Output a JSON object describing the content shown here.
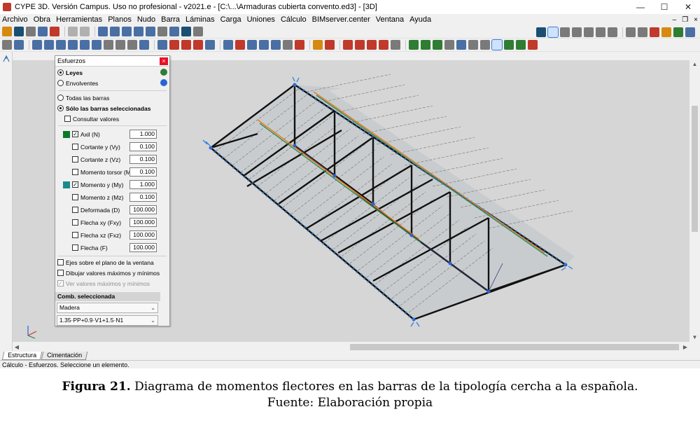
{
  "window": {
    "title": "CYPE 3D. Versión Campus. Uso no profesional - v2021.e - [C:\\...\\Armaduras cubierta convento.ed3] - [3D]",
    "minimize": "—",
    "maximize": "☐",
    "close": "✕",
    "mdi_min": "–",
    "mdi_restore": "❐",
    "mdi_close": "×"
  },
  "menu": [
    "Archivo",
    "Obra",
    "Herramientas",
    "Planos",
    "Nudo",
    "Barra",
    "Láminas",
    "Carga",
    "Uniones",
    "Cálculo",
    "BIMserver.center",
    "Ventana",
    "Ayuda"
  ],
  "panel": {
    "title": "Esfuerzos",
    "close": "×",
    "mode_leyes": "Leyes",
    "mode_envolventes": "Envolventes",
    "all_bars": "Todas las barras",
    "selected_bars": "Sólo las barras seleccionadas",
    "consult_values": "Consultar valores",
    "check_mark": "✓",
    "efforts": [
      {
        "label": "Axil (N)",
        "value": "1.000",
        "checked": true,
        "color": "#0a7a28"
      },
      {
        "label": "Cortante y (Vy)",
        "value": "0.100",
        "checked": false,
        "color": ""
      },
      {
        "label": "Cortante z (Vz)",
        "value": "0.100",
        "checked": false,
        "color": ""
      },
      {
        "label": "Momento torsor (Mt)",
        "value": "0.100",
        "checked": false,
        "color": ""
      },
      {
        "label": "Momento y (My)",
        "value": "1.000",
        "checked": true,
        "color": "#1a8a8a"
      },
      {
        "label": "Momento z (Mz)",
        "value": "0.100",
        "checked": false,
        "color": ""
      },
      {
        "label": "Deformada (D)",
        "value": "100.000",
        "checked": false,
        "color": ""
      },
      {
        "label": "Flecha xy (Fxy)",
        "value": "100.000",
        "checked": false,
        "color": ""
      },
      {
        "label": "Flecha xz (Fxz)",
        "value": "100.000",
        "checked": false,
        "color": ""
      },
      {
        "label": "Flecha (F)",
        "value": "100.000",
        "checked": false,
        "color": ""
      }
    ],
    "axes_on_window_plane": "Ejes sobre el plano de la ventana",
    "draw_max_min": "Dibujar valores máximos y mínimos",
    "see_max_min": "Ver valores máximos y mínimos",
    "comb_header": "Comb. seleccionada",
    "material": "Madera",
    "combination": "1.35·PP+0.9·V1+1.5·N1"
  },
  "tabs": [
    "Estructura",
    "Cimentación"
  ],
  "status": "Cálculo - Esfuerzos. Seleccione un elemento.",
  "caption": {
    "label": "Figura 21.",
    "text": " Diagrama de momentos flectores en las barras de la tipología cercha a la española.",
    "source": "Fuente: Elaboración propia"
  }
}
